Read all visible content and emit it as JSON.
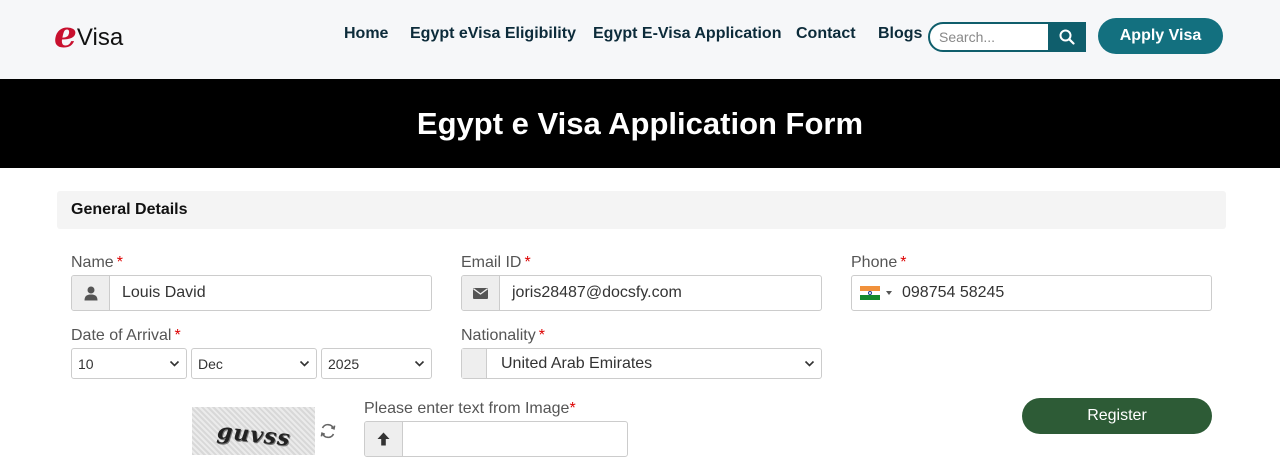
{
  "nav": {
    "logo_letter": "e",
    "logo_word": "Visa",
    "links": [
      "Home",
      "Egypt eVisa Eligibility",
      "Egypt E-Visa Application",
      "Contact",
      "Blogs"
    ],
    "search_placeholder": "Search...",
    "search_icon": "search-icon",
    "apply_label": "Apply Visa"
  },
  "banner": {
    "title": "Egypt e Visa Application Form"
  },
  "section": {
    "title": "General Details"
  },
  "form": {
    "name": {
      "label": "Name",
      "required": "*",
      "value": "Louis David",
      "icon": "user-icon"
    },
    "email": {
      "label": "Email ID",
      "required": "*",
      "value": "joris28487@docsfy.com",
      "icon": "envelope-icon"
    },
    "phone": {
      "label": "Phone",
      "required": "*",
      "value": "098754 58245",
      "country_flag": "india-flag-icon"
    },
    "arrival": {
      "label": "Date of Arrival",
      "required": "*",
      "day": "10",
      "month": "Dec",
      "year": "2025"
    },
    "nationality": {
      "label": "Nationality",
      "required": "*",
      "value": "United Arab Emirates"
    },
    "captcha": {
      "text": "guvss",
      "label": "Please enter text from Image",
      "required": "*",
      "value": "",
      "icon": "upload-arrow-icon"
    },
    "register_label": "Register"
  },
  "colors": {
    "brand_red": "#c8102e",
    "teal": "#13707f",
    "banner_bg": "#000000",
    "register_green": "#2d5b36",
    "required_red": "#dd0000"
  }
}
